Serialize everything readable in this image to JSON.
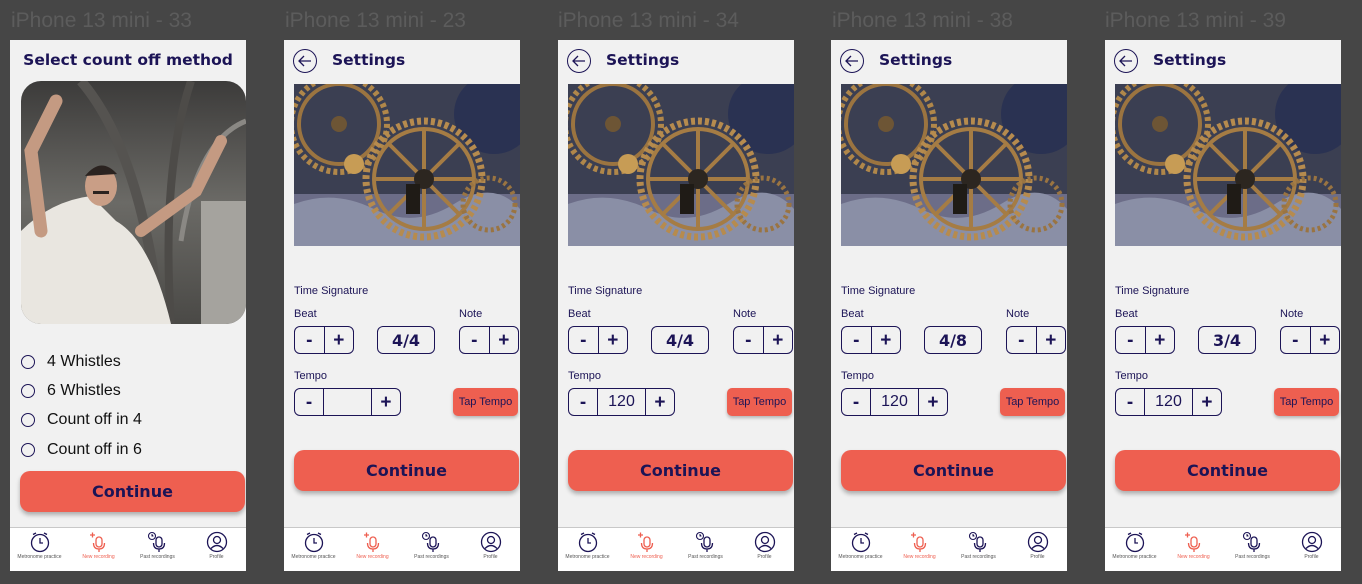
{
  "frames": [
    {
      "title": "iPhone 13 mini - 33"
    },
    {
      "title": "iPhone 13 mini - 23"
    },
    {
      "title": "iPhone 13 mini - 34"
    },
    {
      "title": "iPhone 13 mini - 38"
    },
    {
      "title": "iPhone 13 mini - 39"
    }
  ],
  "count_off": {
    "heading": "Select count off method",
    "options": [
      "4 Whistles",
      "6 Whistles",
      "Count off in 4",
      "Count off in 6"
    ],
    "continue_label": "Continue"
  },
  "settings": {
    "heading": "Settings",
    "time_signature_label": "Time Signature",
    "beat_label": "Beat",
    "note_label": "Note",
    "tempo_label": "Tempo",
    "minus": "-",
    "plus": "+",
    "tap_tempo_label": "Tap Tempo",
    "continue_label": "Continue",
    "screens": [
      {
        "signature": "4/4",
        "tempo": ""
      },
      {
        "signature": "4/4",
        "tempo": "120"
      },
      {
        "signature": "4/8",
        "tempo": "120"
      },
      {
        "signature": "3/4",
        "tempo": "120"
      }
    ]
  },
  "tabbar": {
    "items": [
      {
        "label": "Metronome practice",
        "icon": "clock-icon"
      },
      {
        "label": "New recording",
        "icon": "mic-plus-icon",
        "active": true
      },
      {
        "label": "Past recordings",
        "icon": "mic-history-icon"
      },
      {
        "label": "Profile",
        "icon": "user-circle-icon"
      }
    ]
  },
  "colors": {
    "background": "#464646",
    "screen": "#f1f1f1",
    "accent": "#ee5f50",
    "navy": "#1c1456"
  }
}
